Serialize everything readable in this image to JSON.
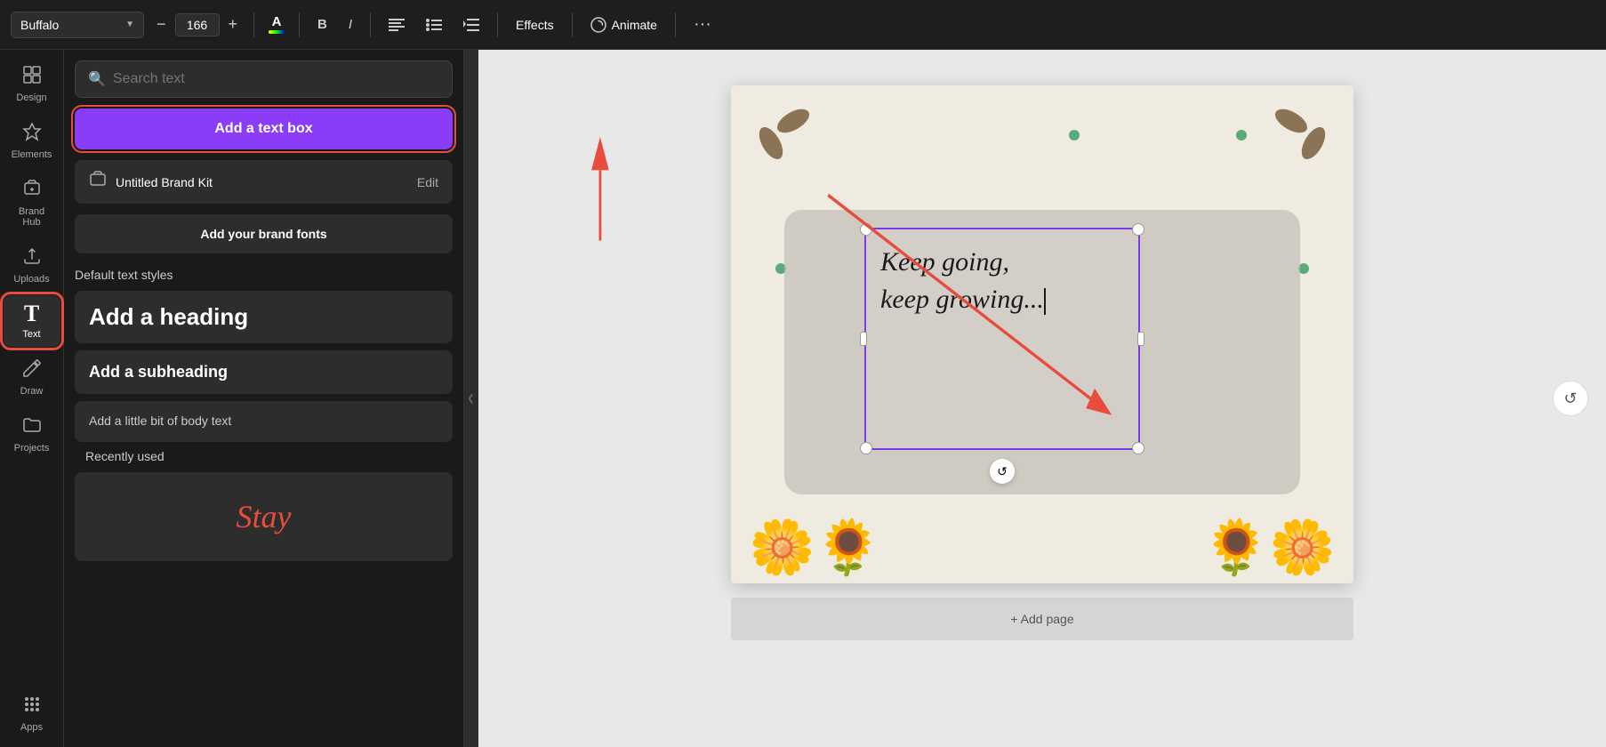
{
  "toolbar": {
    "font_name": "Buffalo",
    "font_size": "166",
    "decrease_label": "−",
    "increase_label": "+",
    "color_letter": "A",
    "bold_label": "B",
    "italic_label": "I",
    "align_icon": "≡",
    "list_icon": "≡",
    "list_adjust_icon": "⇕",
    "effects_label": "Effects",
    "animate_label": "Animate",
    "more_label": "···"
  },
  "sidebar": {
    "items": [
      {
        "id": "design",
        "label": "Design",
        "icon": "⊞"
      },
      {
        "id": "elements",
        "label": "Elements",
        "icon": "✦"
      },
      {
        "id": "brand-hub",
        "label": "Brand Hub",
        "icon": "🏷"
      },
      {
        "id": "uploads",
        "label": "Uploads",
        "icon": "⬆"
      },
      {
        "id": "text",
        "label": "Text",
        "icon": "T"
      },
      {
        "id": "draw",
        "label": "Draw",
        "icon": "✏"
      },
      {
        "id": "projects",
        "label": "Projects",
        "icon": "📁"
      },
      {
        "id": "apps",
        "label": "Apps",
        "icon": "⋮⋮"
      }
    ]
  },
  "panel": {
    "search_placeholder": "Search text",
    "add_textbox_label": "Add a text box",
    "brand_kit_name": "Untitled Brand Kit",
    "brand_kit_edit": "Edit",
    "add_brand_fonts_label": "Add your brand fonts",
    "default_styles_heading": "Default text styles",
    "heading_label": "Add a heading",
    "subheading_label": "Add a subheading",
    "body_label": "Add a little bit of body text",
    "recently_used_heading": "Recently used",
    "stay_text": "Stay"
  },
  "canvas": {
    "text_content_line1": "Keep going,",
    "text_content_line2": "keep growing...",
    "add_page_label": "+ Add page"
  },
  "colors": {
    "add_textbox_bg": "#8b3cf7",
    "selection_border": "#7c3aed",
    "red_accent": "#e74c3c"
  }
}
